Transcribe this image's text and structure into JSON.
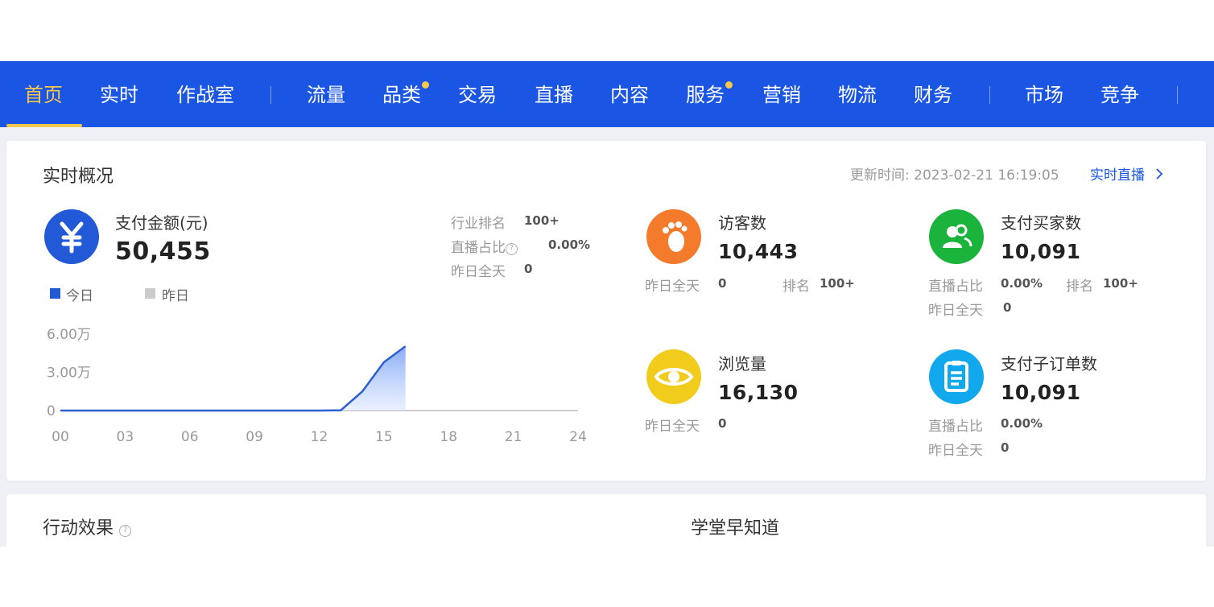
{
  "nav": {
    "items": [
      {
        "label": "首页",
        "active": true,
        "dot": false
      },
      {
        "label": "实时",
        "active": false,
        "dot": false
      },
      {
        "label": "作战室",
        "active": false,
        "dot": false
      },
      {
        "label": "流量",
        "active": false,
        "dot": false
      },
      {
        "label": "品类",
        "active": false,
        "dot": true
      },
      {
        "label": "交易",
        "active": false,
        "dot": false
      },
      {
        "label": "直播",
        "active": false,
        "dot": false
      },
      {
        "label": "内容",
        "active": false,
        "dot": false
      },
      {
        "label": "服务",
        "active": false,
        "dot": true
      },
      {
        "label": "营销",
        "active": false,
        "dot": false
      },
      {
        "label": "物流",
        "active": false,
        "dot": false
      },
      {
        "label": "财务",
        "active": false,
        "dot": false
      },
      {
        "label": "市场",
        "active": false,
        "dot": false
      },
      {
        "label": "竞争",
        "active": false,
        "dot": false
      }
    ],
    "bg_color": "#1a55e3",
    "active_color": "#f3c84b"
  },
  "overview": {
    "title": "实时概况",
    "update_label": "更新时间:",
    "update_time": "2023-02-21 16:19:05",
    "live_link": "实时直播",
    "payment": {
      "icon": "yuan-icon",
      "label": "支付金额(元)",
      "value": "50,455",
      "industry_rank_label": "行业排名",
      "industry_rank": "100+",
      "live_share_label": "直播占比",
      "live_share": "0.00%",
      "yesterday_label": "昨日全天",
      "yesterday": "0"
    },
    "legend": {
      "today": "今日",
      "yesterday": "昨日"
    },
    "visitors": {
      "icon": "footprint-icon",
      "label": "访客数",
      "value": "10,443",
      "yesterday_label": "昨日全天",
      "yesterday": "0",
      "rank_label": "排名",
      "rank": "100+"
    },
    "buyers": {
      "icon": "users-icon",
      "label": "支付买家数",
      "value": "10,091",
      "live_share_label": "直播占比",
      "live_share": "0.00%",
      "rank_label": "排名",
      "rank": "100+",
      "yesterday_label": "昨日全天",
      "yesterday": "0"
    },
    "pageviews": {
      "icon": "eye-icon",
      "label": "浏览量",
      "value": "16,130",
      "yesterday_label": "昨日全天",
      "yesterday": "0"
    },
    "sub_orders": {
      "icon": "clipboard-icon",
      "label": "支付子订单数",
      "value": "10,091",
      "live_share_label": "直播占比",
      "live_share": "0.00%",
      "yesterday_label": "昨日全天",
      "yesterday": "0"
    },
    "colors": {
      "payment": "#2259d6",
      "visitors": "#f47a2c",
      "buyers": "#1ab33c",
      "pageviews": "#f2cc1d",
      "sub_orders": "#12a8ee"
    }
  },
  "chart_data": {
    "type": "area",
    "x_ticks": [
      "00",
      "03",
      "06",
      "09",
      "12",
      "15",
      "18",
      "21",
      "24"
    ],
    "y_ticks": [
      "6.00万",
      "3.00万",
      "0"
    ],
    "ylim": [
      0,
      60000
    ],
    "xlim": [
      0,
      24
    ],
    "series": [
      {
        "name": "今日",
        "x": [
          0,
          1,
          2,
          3,
          4,
          5,
          6,
          7,
          8,
          9,
          10,
          11,
          12,
          13,
          14,
          15,
          16
        ],
        "y": [
          0,
          0,
          0,
          0,
          0,
          0,
          0,
          0,
          0,
          0,
          0,
          0,
          0,
          200,
          15000,
          38000,
          50455
        ]
      },
      {
        "name": "昨日",
        "x": [
          0,
          24
        ],
        "y": [
          0,
          0
        ]
      }
    ]
  },
  "actions": {
    "title": "行动效果",
    "academy_title": "学堂早知道"
  }
}
